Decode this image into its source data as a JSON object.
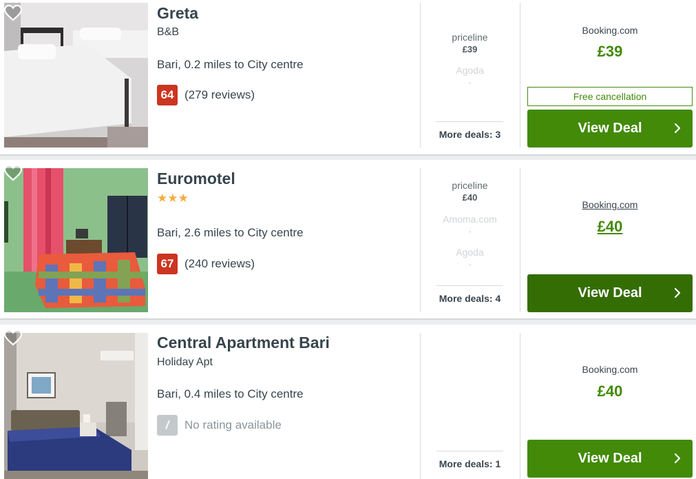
{
  "listings": [
    {
      "name": "Greta",
      "type": "B&B",
      "stars": "",
      "location": "Bari, 0.2 miles to City centre",
      "score": "64",
      "reviews": "(279 reviews)",
      "others": [
        {
          "provider": "priceline",
          "price": "£39",
          "dim": false
        },
        {
          "provider": "Agoda",
          "price": "-",
          "dim": true
        }
      ],
      "more_deals": "More deals: 3",
      "best_provider": "Booking.com",
      "best_price": "£39",
      "free_cancellation": "Free cancellation",
      "view_deal": "View Deal"
    },
    {
      "name": "Euromotel",
      "type": "",
      "stars": "★★★",
      "star_rating": 3,
      "location": "Bari, 2.6 miles to City centre",
      "score": "67",
      "reviews": "(240 reviews)",
      "others": [
        {
          "provider": "priceline",
          "price": "£40",
          "dim": false
        },
        {
          "provider": "Amoma.com",
          "price": "-",
          "dim": true
        },
        {
          "provider": "Agoda",
          "price": "-",
          "dim": true
        }
      ],
      "more_deals": "More deals: 4",
      "best_provider": "Booking.com",
      "best_price": "£40",
      "view_deal": "View Deal"
    },
    {
      "name": "Central Apartment Bari",
      "type": "Holiday Apt",
      "stars": "",
      "location": "Bari, 0.4 miles to City centre",
      "score": "/",
      "reviews": "No rating available",
      "others": [],
      "more_deals": "More deals: 1",
      "best_provider": "Booking.com",
      "best_price": "£40",
      "view_deal": "View Deal"
    }
  ],
  "icons": {
    "favourite": "heart-outline-icon",
    "chevron": "chevron-right-icon"
  },
  "colors": {
    "deal_green": "#428a08",
    "deal_green_hover": "#346d04",
    "score_red": "#cc3520",
    "star_orange": "#f6ab3f",
    "text": "#37454d"
  }
}
